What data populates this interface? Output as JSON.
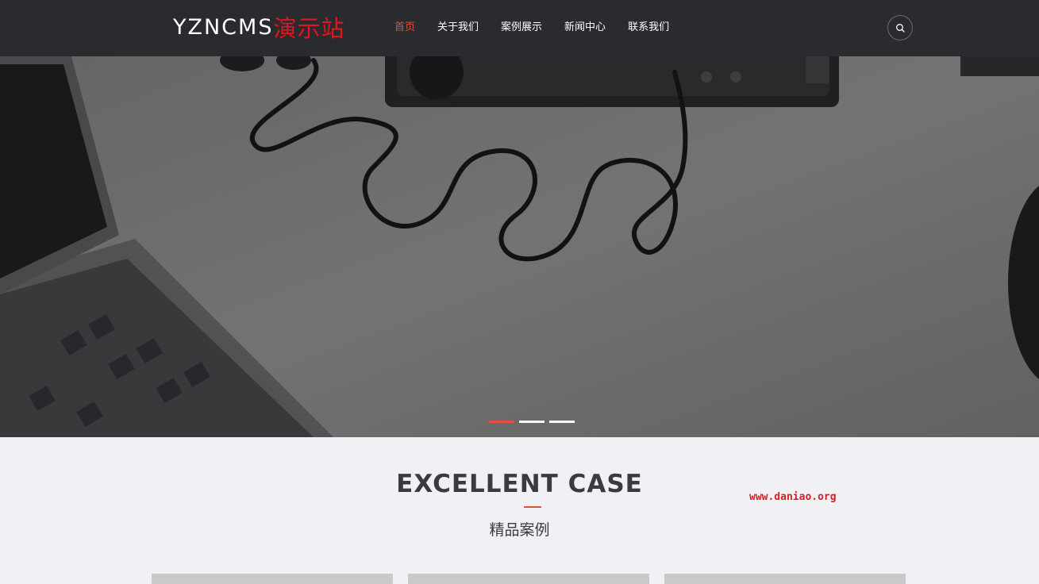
{
  "header": {
    "logo_latin": "YZNCMS",
    "logo_cjk": "演示站",
    "nav": [
      "首页",
      "关于我们",
      "案例展示",
      "新闻中心",
      "联系我们"
    ],
    "active_nav_index": 0,
    "search_icon": "search-icon"
  },
  "banner": {
    "slide_count": 3,
    "active_slide": 0
  },
  "section": {
    "title": "EXCELLENT CASE",
    "subtitle": "精品案例",
    "watermark": "www.daniao.org"
  },
  "colors": {
    "header_bg": "#2a2b2f",
    "accent": "#e0523e",
    "logo_red": "#e0151f",
    "page_bg": "#f1f0f4"
  }
}
